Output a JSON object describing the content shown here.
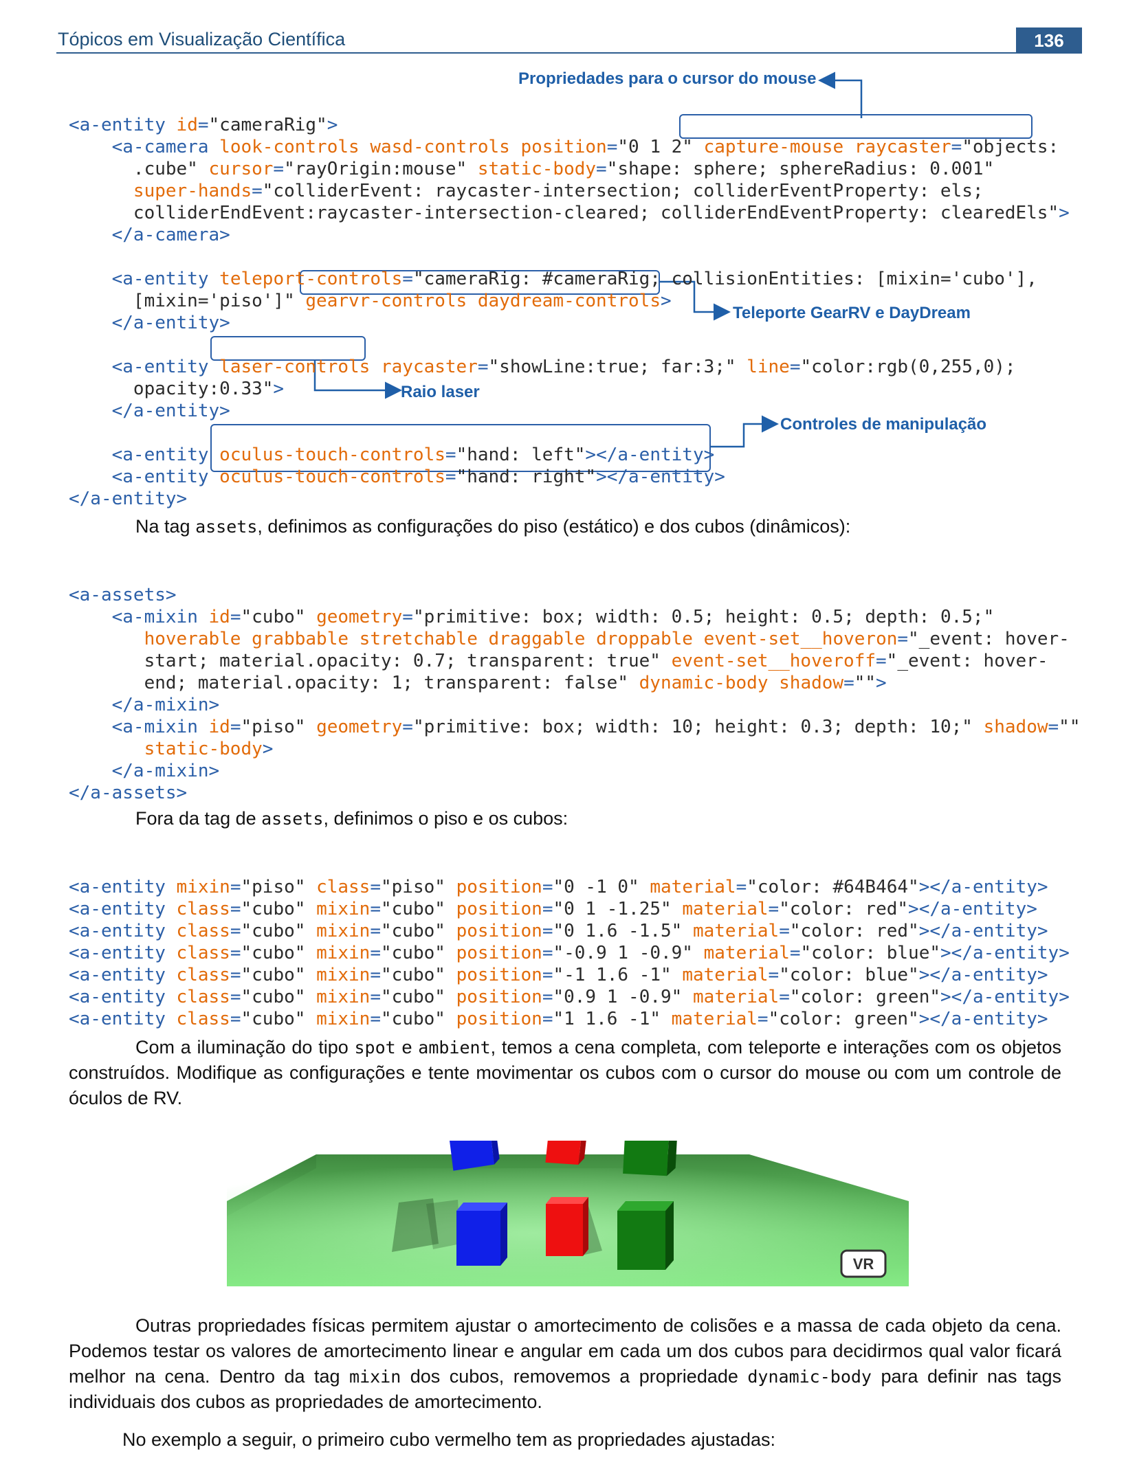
{
  "header": {
    "title": "Tópicos em Visualização Científica",
    "page_number": "136"
  },
  "annotations": {
    "mouse_cursor": "Propriedades para o cursor do mouse",
    "teleport": "Teleporte GearRV e DayDream",
    "laser": "Raio laser",
    "manipulation": "Controles de manipulação"
  },
  "code_rig": {
    "l1": "<a-entity id=\"cameraRig\">",
    "l2": "    <a-camera look-controls wasd-controls position=\"0 1 2\" capture-mouse raycaster=\"objects:",
    "l3": "      .cube\" cursor=\"rayOrigin:mouse\" static-body=\"shape: sphere; sphereRadius: 0.001\"",
    "l4": "      super-hands=\"colliderEvent: raycaster-intersection; colliderEventProperty: els;",
    "l5": "      colliderEndEvent:raycaster-intersection-cleared; colliderEndEventProperty: clearedEls\">",
    "l6": "    </a-camera>",
    "l7": "    <a-entity teleport-controls=\"cameraRig: #cameraRig; collisionEntities: [mixin='cubo'],",
    "l8": "      [mixin='piso']\" gearvr-controls daydream-controls>",
    "l9": "    </a-entity>",
    "l10": "    <a-entity laser-controls raycaster=\"showLine:true; far:3;\" line=\"color:rgb(0,255,0);",
    "l11": "      opacity:0.33\">",
    "l12": "    </a-entity>",
    "l13": "    <a-entity oculus-touch-controls=\"hand: left\"></a-entity>",
    "l14": "    <a-entity oculus-touch-controls=\"hand: right\"></a-entity>",
    "l15": "</a-entity>"
  },
  "para_assets": {
    "before": "Na tag ",
    "code": "assets",
    "after": ", definimos as configurações do piso (estático) e dos cubos (dinâmicos):"
  },
  "code_assets": {
    "l1": "<a-assets>",
    "l2": "    <a-mixin id=\"cubo\" geometry=\"primitive: box; width: 0.5; height: 0.5; depth: 0.5;\"",
    "l3": "       hoverable grabbable stretchable draggable droppable event-set__hoveron=\"_event: hover-",
    "l4": "       start; material.opacity: 0.7; transparent: true\" event-set__hoveroff=\"_event: hover-",
    "l5": "       end; material.opacity: 1; transparent: false\" dynamic-body shadow=\"\">",
    "l6": "    </a-mixin>",
    "l7": "    <a-mixin id=\"piso\" geometry=\"primitive: box; width: 10; height: 0.3; depth: 10;\" shadow=\"\"",
    "l8": "       static-body>",
    "l9": "    </a-mixin>",
    "l10": "</a-assets>"
  },
  "para_outside": {
    "before": "Fora da tag de ",
    "code": "assets",
    "after": ", definimos o piso e os cubos:"
  },
  "code_entities": {
    "l1": "<a-entity mixin=\"piso\" class=\"piso\" position=\"0 -1 0\" material=\"color: #64B464\"></a-entity>",
    "l2": "<a-entity class=\"cubo\" mixin=\"cubo\" position=\"0 1 -1.25\" material=\"color: red\"></a-entity>",
    "l3": "<a-entity class=\"cubo\" mixin=\"cubo\" position=\"0 1.6 -1.5\" material=\"color: red\"></a-entity>",
    "l4": "<a-entity class=\"cubo\" mixin=\"cubo\" position=\"-0.9 1 -0.9\" material=\"color: blue\"></a-entity>",
    "l5": "<a-entity class=\"cubo\" mixin=\"cubo\" position=\"-1 1.6 -1\" material=\"color: blue\"></a-entity>",
    "l6": "<a-entity class=\"cubo\" mixin=\"cubo\" position=\"0.9 1 -0.9\" material=\"color: green\"></a-entity>",
    "l7": "<a-entity class=\"cubo\" mixin=\"cubo\" position=\"1 1.6 -1\" material=\"color: green\"></a-entity>"
  },
  "para_lighting": {
    "p1": "Com a iluminação do tipo ",
    "c1": "spot",
    "p2": " e ",
    "c2": "ambient",
    "p3": ", temos a cena completa, com teleporte e interações com os objetos construídos. Modifique as configurações e tente movimentar os cubos com o cursor do mouse ou com um controle de óculos de RV."
  },
  "scene": {
    "vr_button": "VR",
    "floor_color": "#64B464"
  },
  "para_physics": {
    "p1": "Outras propriedades físicas permitem ajustar o amortecimento de colisões e a massa de cada objeto da cena. Podemos testar os valores de amortecimento linear e angular em cada um dos cubos para decidirmos qual valor ficará melhor na cena. Dentro da tag ",
    "c1": "mixin",
    "p2": " dos cubos, removemos a propriedade ",
    "c2": "dynamic-body",
    "p3": " para definir nas tags individuais dos cubos as propriedades de amortecimento."
  },
  "para_example": "No exemplo a seguir, o primeiro cubo vermelho tem as propriedades ajustadas:"
}
